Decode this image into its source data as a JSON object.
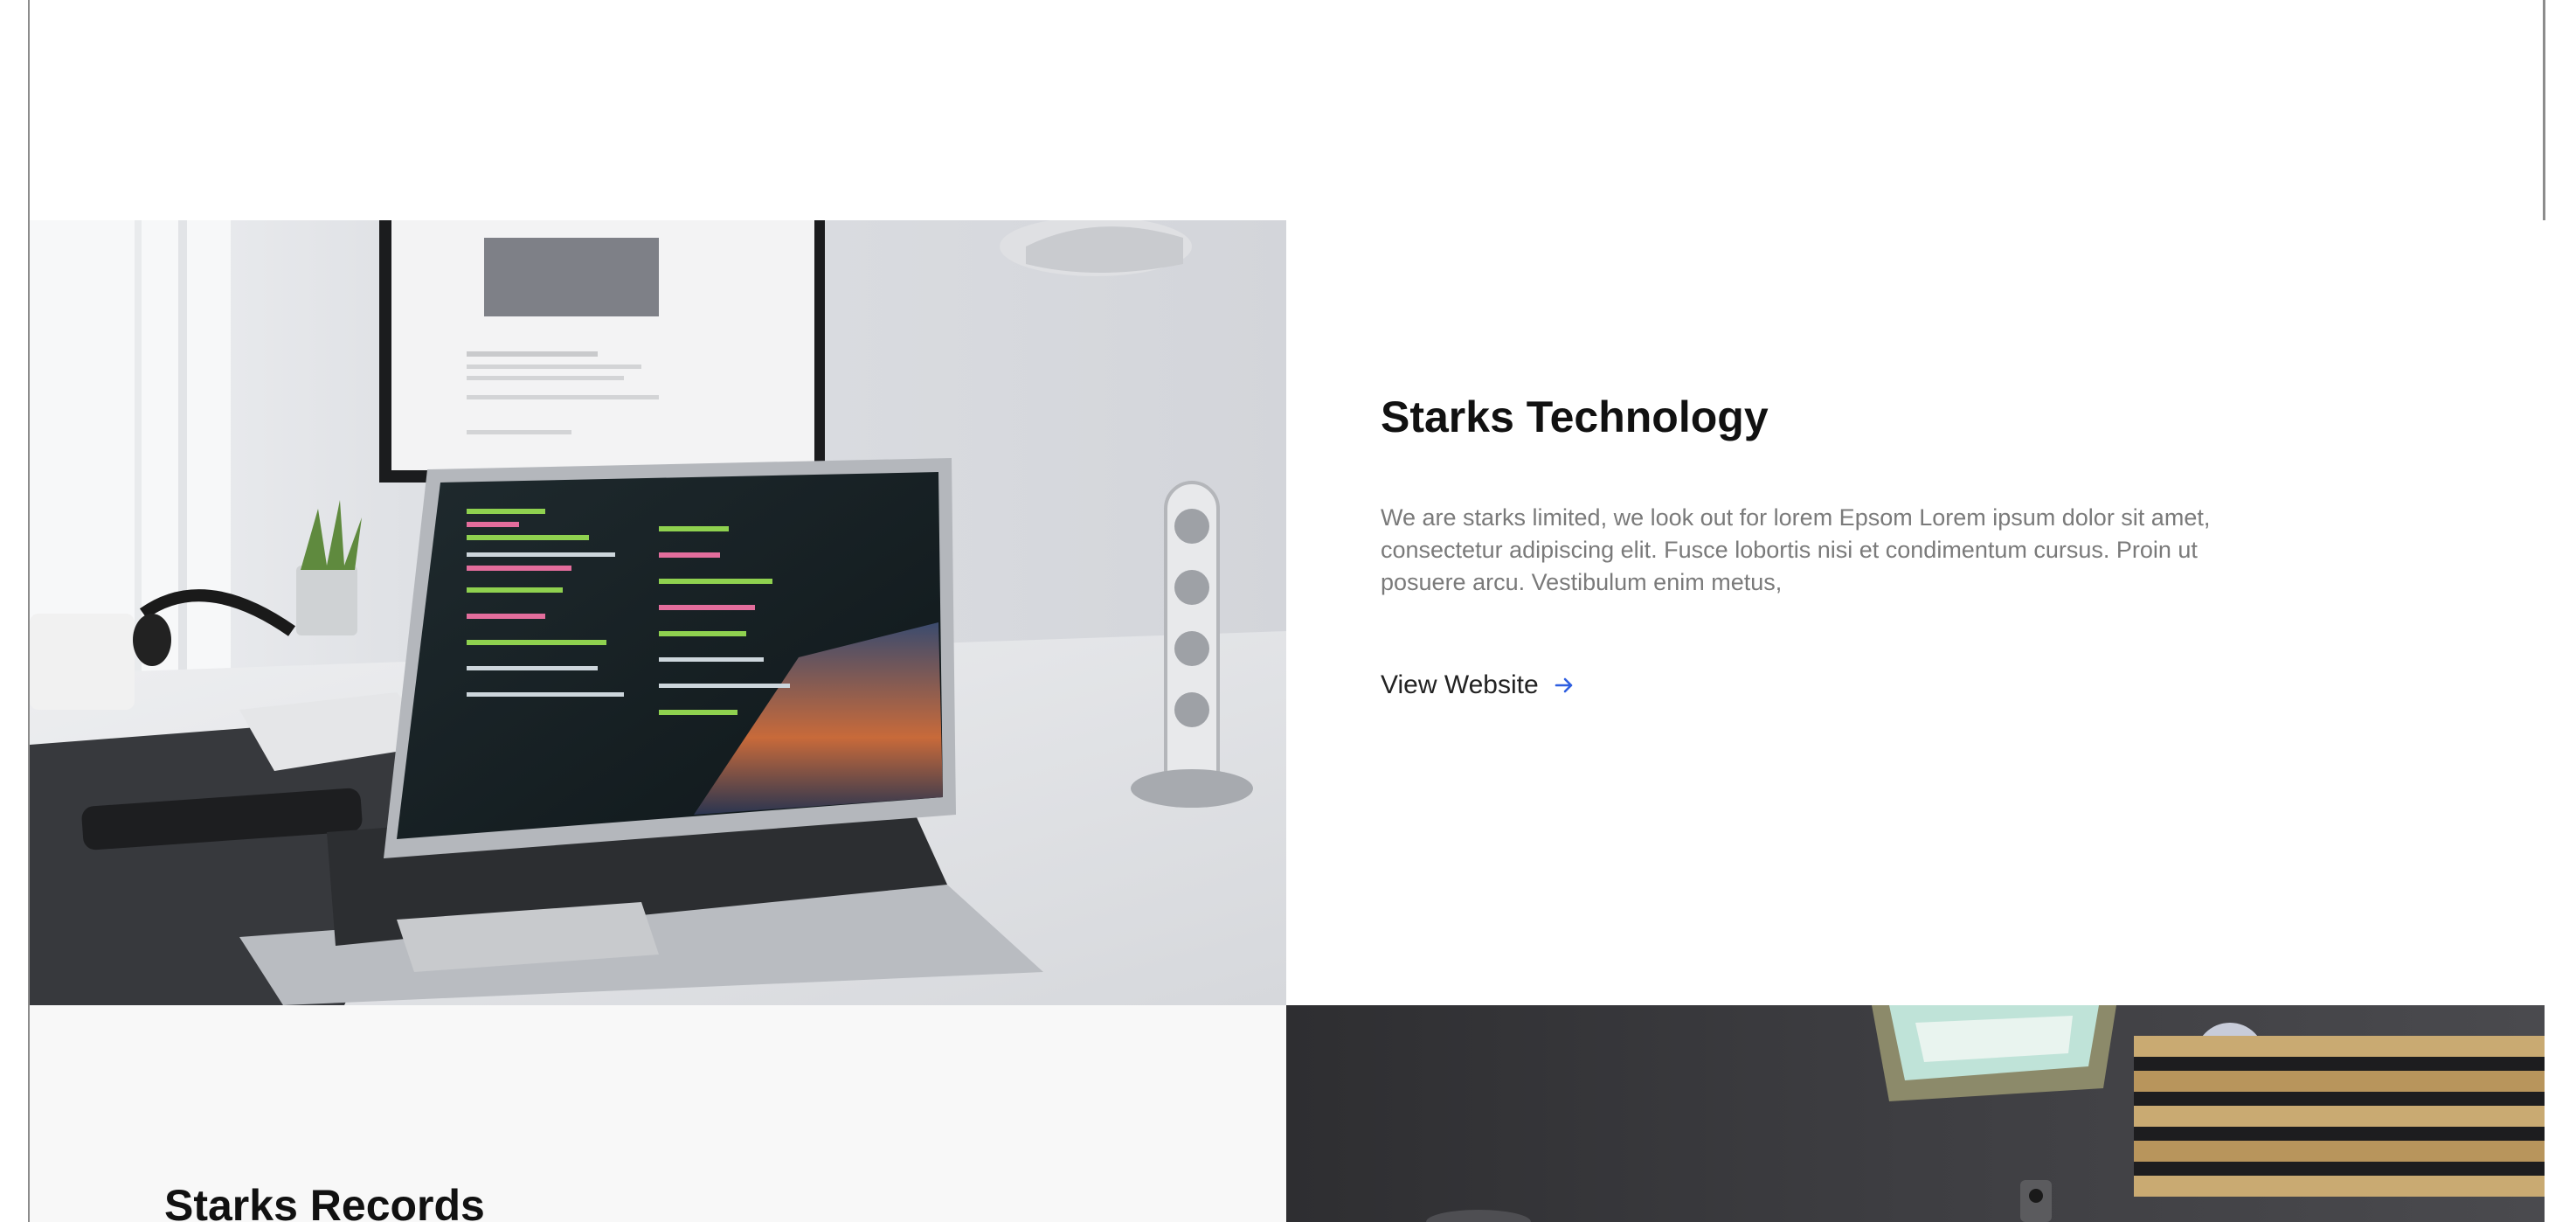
{
  "projects": [
    {
      "title": "Starks Technology",
      "description": "We are starks limited, we look out for lorem Epsom Lorem ipsum dolor sit amet, consectetur adipiscing elit. Fusce lobortis nisi et condimentum cursus. Proin ut posuere arcu. Vestibulum enim metus,",
      "link_label": "View Website",
      "link_icon": "arrow-right-icon",
      "image": "laptop-on-desk-photo"
    },
    {
      "title": "Starks Records",
      "image": "recording-studio-photo"
    }
  ],
  "colors": {
    "title": "#111111",
    "description": "#7a7a7a",
    "link": "#222222",
    "arrow_accent": "#2f5fe0",
    "alt_row_background": "#f8f8f8"
  }
}
